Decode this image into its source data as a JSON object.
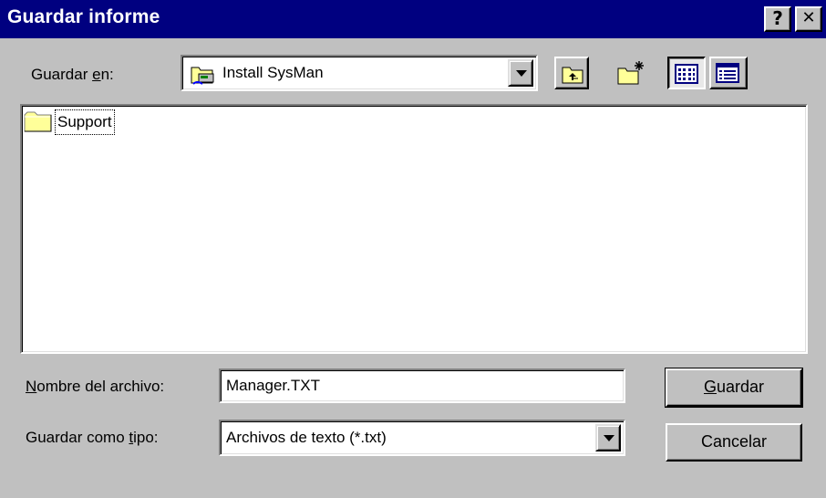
{
  "window": {
    "title": "Guardar informe",
    "help_label": "?",
    "close_label": "✕"
  },
  "save_in": {
    "label_pre": "Guardar ",
    "label_accel": "e",
    "label_post": "n:",
    "value": "Install SysMan",
    "icon": "drive-folder-icon"
  },
  "toolbar": {
    "buttons": [
      {
        "name": "up-one-level-button",
        "icon": "folder-up-icon"
      },
      {
        "name": "new-folder-button",
        "icon": "new-folder-icon"
      },
      {
        "name": "list-view-button",
        "icon": "list-view-icon",
        "pressed": true
      },
      {
        "name": "details-view-button",
        "icon": "details-view-icon"
      }
    ]
  },
  "files": [
    {
      "name": "Support",
      "type": "folder",
      "icon": "folder-icon"
    }
  ],
  "file_name": {
    "label_accel": "N",
    "label_post": "ombre del archivo:",
    "value": "Manager.TXT"
  },
  "file_type": {
    "label_pre": "Guardar como ",
    "label_accel": "t",
    "label_post": "ipo:",
    "value": "Archivos de texto (*.txt)"
  },
  "buttons": {
    "save_accel": "G",
    "save_post": "uardar",
    "cancel": "Cancelar"
  },
  "colors": {
    "title_bar": "#000080",
    "face": "#c0c0c0",
    "folder": "#ffff99"
  }
}
